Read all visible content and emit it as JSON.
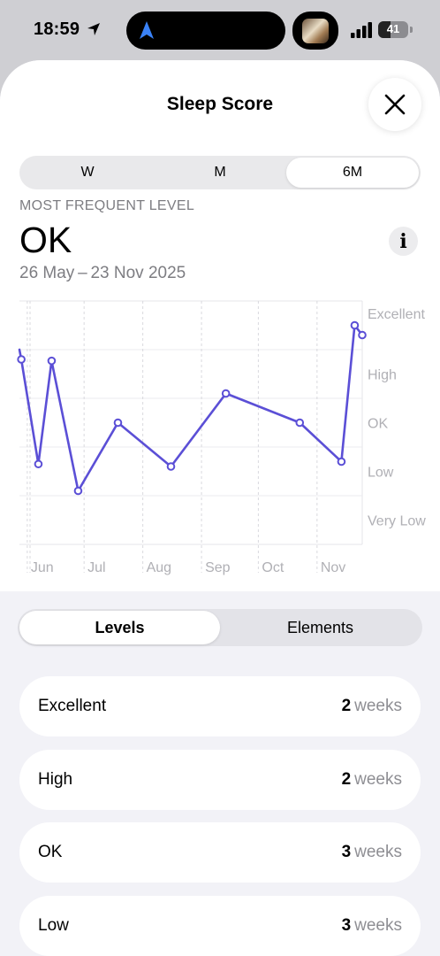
{
  "status_bar": {
    "time": "18:59",
    "battery": "41",
    "battery_level": 0.41
  },
  "sheet": {
    "title": "Sleep Score"
  },
  "range_selector": {
    "options": [
      "W",
      "M",
      "6M"
    ],
    "selected": "6M"
  },
  "summary": {
    "caption": "MOST FREQUENT LEVEL",
    "value": "OK",
    "date_range": "26 May – 23 Nov 2025"
  },
  "chart_data": {
    "type": "line",
    "color": "#5b4fd6",
    "y_levels": [
      "Very Low",
      "Low",
      "OK",
      "High",
      "Excellent"
    ],
    "x_ticks": [
      "Jun",
      "Jul",
      "Aug",
      "Sep",
      "Oct",
      "Nov"
    ],
    "x_tick_days": [
      6,
      36,
      67,
      98,
      128,
      159
    ],
    "x_range_days": [
      0,
      181
    ],
    "y_range": [
      0,
      5
    ],
    "grid": true,
    "points": [
      {
        "day": 0,
        "y": 4.0
      },
      {
        "day": 1,
        "y": 3.8
      },
      {
        "day": 10,
        "y": 1.65
      },
      {
        "day": 17,
        "y": 3.77
      },
      {
        "day": 31,
        "y": 1.1
      },
      {
        "day": 52,
        "y": 2.5
      },
      {
        "day": 80,
        "y": 1.6
      },
      {
        "day": 109,
        "y": 3.1
      },
      {
        "day": 148,
        "y": 2.5
      },
      {
        "day": 170,
        "y": 1.7
      },
      {
        "day": 177,
        "y": 4.5
      },
      {
        "day": 181,
        "y": 4.3
      }
    ]
  },
  "tabs": {
    "options": [
      "Levels",
      "Elements"
    ],
    "selected": "Levels"
  },
  "levels": [
    {
      "name": "Excellent",
      "count": "2",
      "unit": "weeks"
    },
    {
      "name": "High",
      "count": "2",
      "unit": "weeks"
    },
    {
      "name": "OK",
      "count": "3",
      "unit": "weeks"
    },
    {
      "name": "Low",
      "count": "3",
      "unit": "weeks"
    }
  ]
}
